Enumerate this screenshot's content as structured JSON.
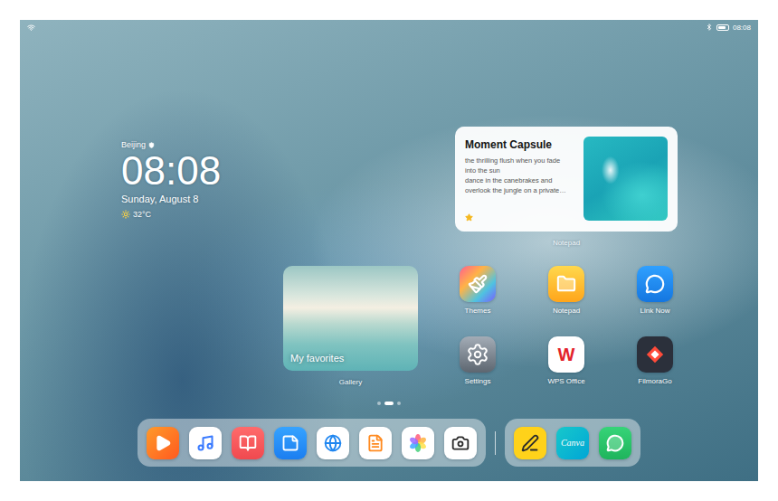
{
  "status_bar": {
    "time": "08:08",
    "battery": {
      "level": 0.85
    }
  },
  "clock_widget": {
    "city": "Beijing",
    "time": "08:08",
    "date": "Sunday, August 8",
    "temperature": "32°C"
  },
  "note_widget": {
    "title": "Moment Capsule",
    "lines": [
      "the thrilling flush when you fade",
      "into the sun",
      "dance in the canebrakes and",
      "overlook the jungle on a private…"
    ],
    "starred": true,
    "label": "Notepad"
  },
  "gallery_widget": {
    "caption": "My favorites",
    "label": "Gallery"
  },
  "apps": [
    {
      "label": "Themes",
      "kind": "themes"
    },
    {
      "label": "Notepad",
      "kind": "notepad"
    },
    {
      "label": "Link Now",
      "kind": "linknow"
    },
    {
      "label": "Settings",
      "kind": "settings"
    },
    {
      "label": "WPS Office",
      "kind": "wps",
      "glyph": "W"
    },
    {
      "label": "FilmoraGo",
      "kind": "filmora"
    }
  ],
  "pages": [
    {
      "selected": false
    },
    {
      "selected": true
    },
    {
      "selected": false
    }
  ],
  "dock": {
    "apps": [
      {
        "kind": "video"
      },
      {
        "kind": "music"
      },
      {
        "kind": "books"
      },
      {
        "kind": "memo"
      },
      {
        "kind": "browser"
      },
      {
        "kind": "docs"
      },
      {
        "kind": "gallery"
      },
      {
        "kind": "camera"
      }
    ],
    "recent": [
      {
        "kind": "pen"
      },
      {
        "kind": "canva",
        "glyph": "Canva"
      },
      {
        "kind": "chat"
      }
    ]
  }
}
